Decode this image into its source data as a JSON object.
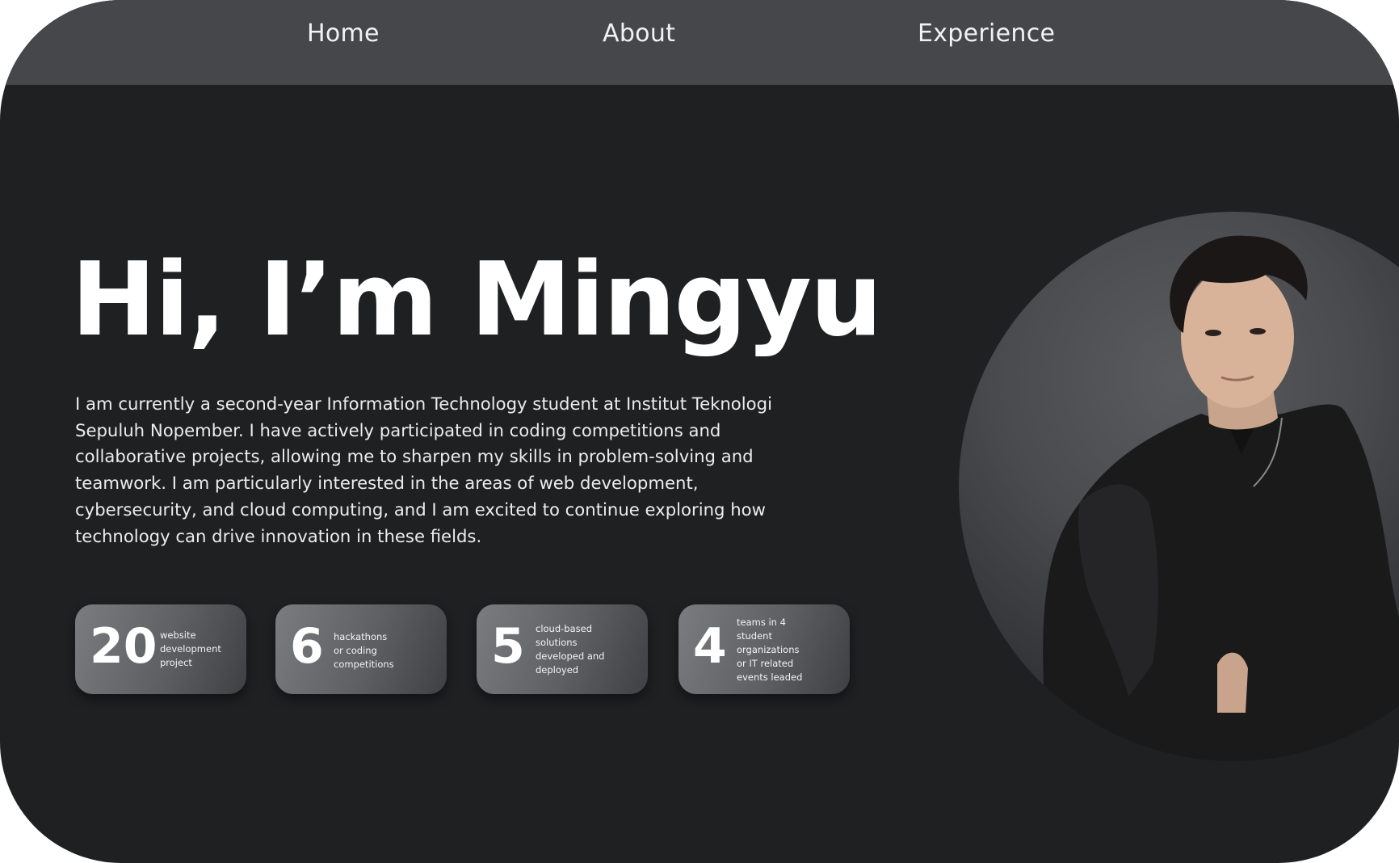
{
  "nav": {
    "items": [
      {
        "label": "Home"
      },
      {
        "label": "About"
      },
      {
        "label": "Experience"
      }
    ]
  },
  "hero": {
    "title": "Hi, I’m Mingyu",
    "description": "I am currently a second-year Information Technology student at Institut Teknologi Sepuluh Nopember.  I have actively participated in coding competitions and collaborative projects, allowing me to sharpen my skills in problem-solving and teamwork. I am particularly interested in the areas of web development, cybersecurity, and cloud computing, and I am excited to continue exploring how technology can drive innovation in these fields."
  },
  "stats": [
    {
      "number": "20",
      "label": "website\ndevelopment\nproject"
    },
    {
      "number": "6",
      "label": "hackathons\nor coding\ncompetitions"
    },
    {
      "number": "5",
      "label": "cloud-based\nsolutions\ndeveloped and\ndeployed"
    },
    {
      "number": "4",
      "label": "teams in 4\nstudent\norganizations\nor IT related\nevents leaded"
    }
  ],
  "profile_photo": {
    "icon": "portrait-photo"
  },
  "colors": {
    "background": "#1f2022",
    "navbar": "#45474b",
    "text": "#ffffff",
    "card": "#6a6c70"
  }
}
